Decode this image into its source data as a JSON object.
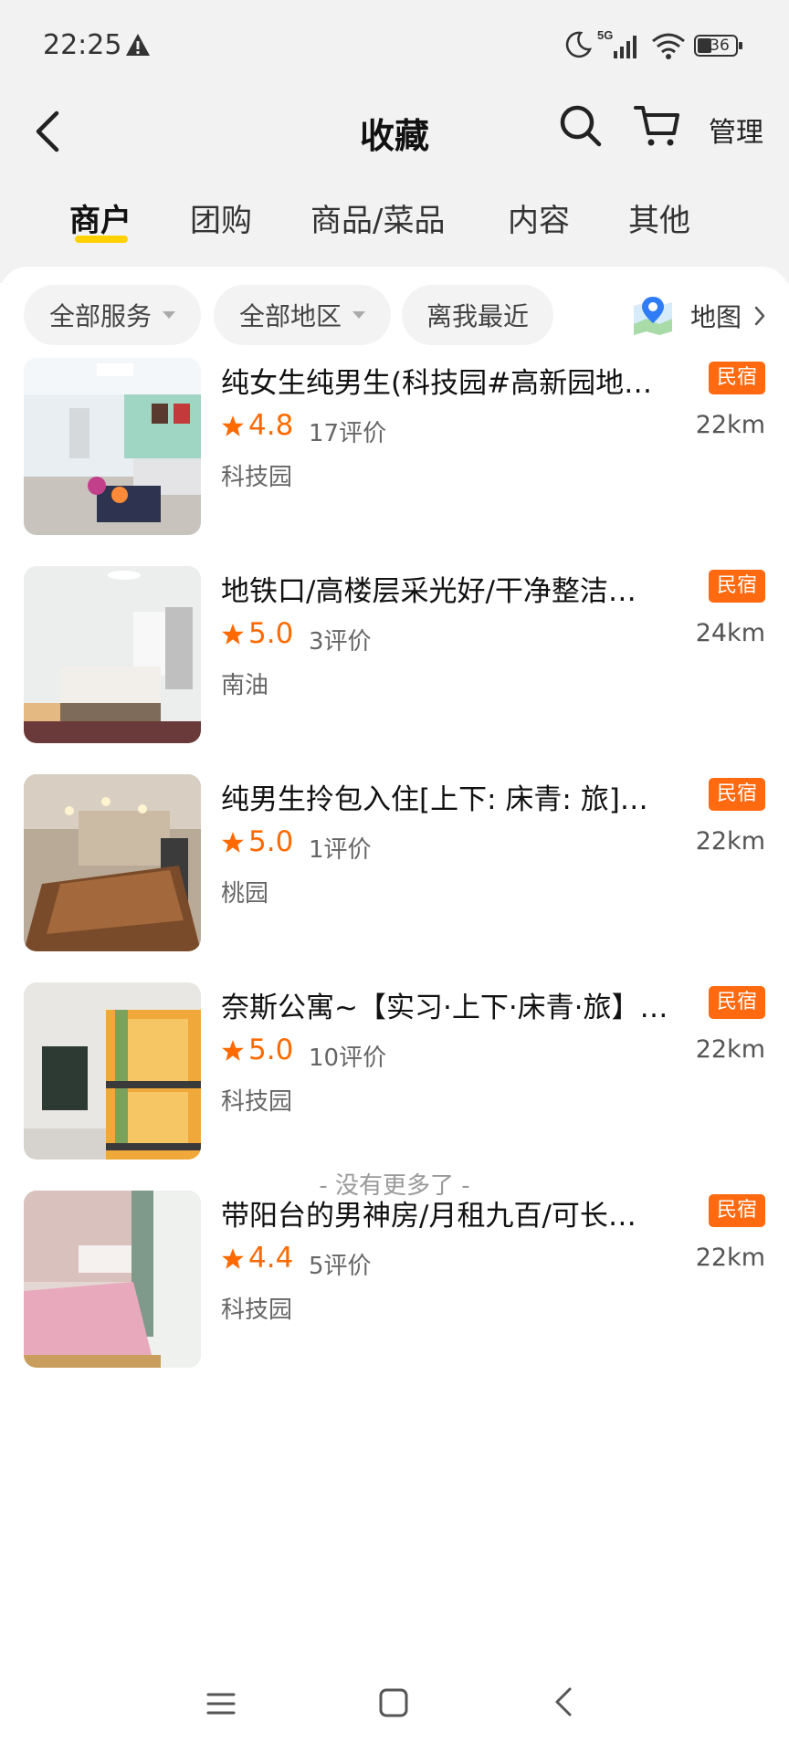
{
  "status_bar": {
    "time": "22:25",
    "battery": "36",
    "icons": [
      "warning-icon",
      "moon-icon",
      "signal-5g-icon",
      "wifi-icon",
      "battery-icon"
    ]
  },
  "header": {
    "title": "收藏",
    "manage_label": "管理",
    "icons": [
      "back-icon",
      "search-icon",
      "cart-icon"
    ]
  },
  "tabs": [
    {
      "label": "商户",
      "active": true
    },
    {
      "label": "团购",
      "active": false
    },
    {
      "label": "商品/菜品",
      "active": false
    },
    {
      "label": "内容",
      "active": false
    },
    {
      "label": "其他",
      "active": false
    }
  ],
  "filters": {
    "service": "全部服务",
    "region": "全部地区",
    "sort": "离我最近",
    "map": "地图"
  },
  "listings": [
    {
      "title": "纯女生纯男生(科技园#高新园地…",
      "rating": "4.8",
      "reviews": "17评价",
      "area": "科技园",
      "badge": "民宿",
      "distance": "22km"
    },
    {
      "title": "地铁口/高楼层采光好/干净整洁…",
      "rating": "5.0",
      "reviews": "3评价",
      "area": "南油",
      "badge": "民宿",
      "distance": "24km"
    },
    {
      "title": "纯男生拎包入住[上下: 床青: 旅]…",
      "rating": "5.0",
      "reviews": "1评价",
      "area": "桃园",
      "badge": "民宿",
      "distance": "22km"
    },
    {
      "title": "奈斯公寓~【实习·上下·床青·旅】…",
      "rating": "5.0",
      "reviews": "10评价",
      "area": "科技园",
      "badge": "民宿",
      "distance": "22km"
    },
    {
      "title": "带阳台的男神房/月租九百/可长…",
      "rating": "4.4",
      "reviews": "5评价",
      "area": "科技园",
      "badge": "民宿",
      "distance": "22km"
    }
  ],
  "footer": {
    "end_text": "- 没有更多了 -"
  },
  "colors": {
    "accent_orange": "#FF6A00",
    "tab_underline": "#FFD100",
    "badge_bg": "#FF6A10",
    "top_background": "#f2f2f2"
  }
}
